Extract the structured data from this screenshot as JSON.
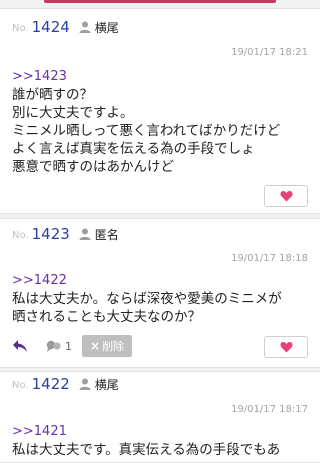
{
  "posts": [
    {
      "no_label": "No.",
      "number": "1424",
      "author": "横尾",
      "date": "19/01/17 18:21",
      "reply_to": ">>1423",
      "lines": [
        "誰が晒すの？",
        "別に大丈夫ですよ。",
        "ミニメル晒しって悪く言われてばかりだけど",
        "よく言えば真実を伝える為の手段でしょ",
        "悪意で晒すのはあかんけど"
      ]
    },
    {
      "no_label": "No.",
      "number": "1423",
      "author": "匿名",
      "date": "19/01/17 18:18",
      "reply_to": ">>1422",
      "lines": [
        "私は大丈夫か。ならば深夜や愛美のミニメが",
        "晒されることも大丈夫なのか？"
      ],
      "reply_count": "1",
      "delete_label": "削除"
    },
    {
      "no_label": "No.",
      "number": "1422",
      "author": "横尾",
      "date": "19/01/17 18:17",
      "reply_to": ">>1421",
      "lines": [
        "私は大丈夫です。真実伝える為の手段でもあ"
      ]
    }
  ],
  "colors": {
    "number": "#2a3fa6",
    "reply_link": "#6a2fa8",
    "heart": "#e8407a",
    "accent_bar": "#c93a5e"
  },
  "icons": {
    "user": "user-icon",
    "heart": "heart-icon",
    "reply": "reply-arrow-icon",
    "comment": "comment-bubble-icon"
  }
}
